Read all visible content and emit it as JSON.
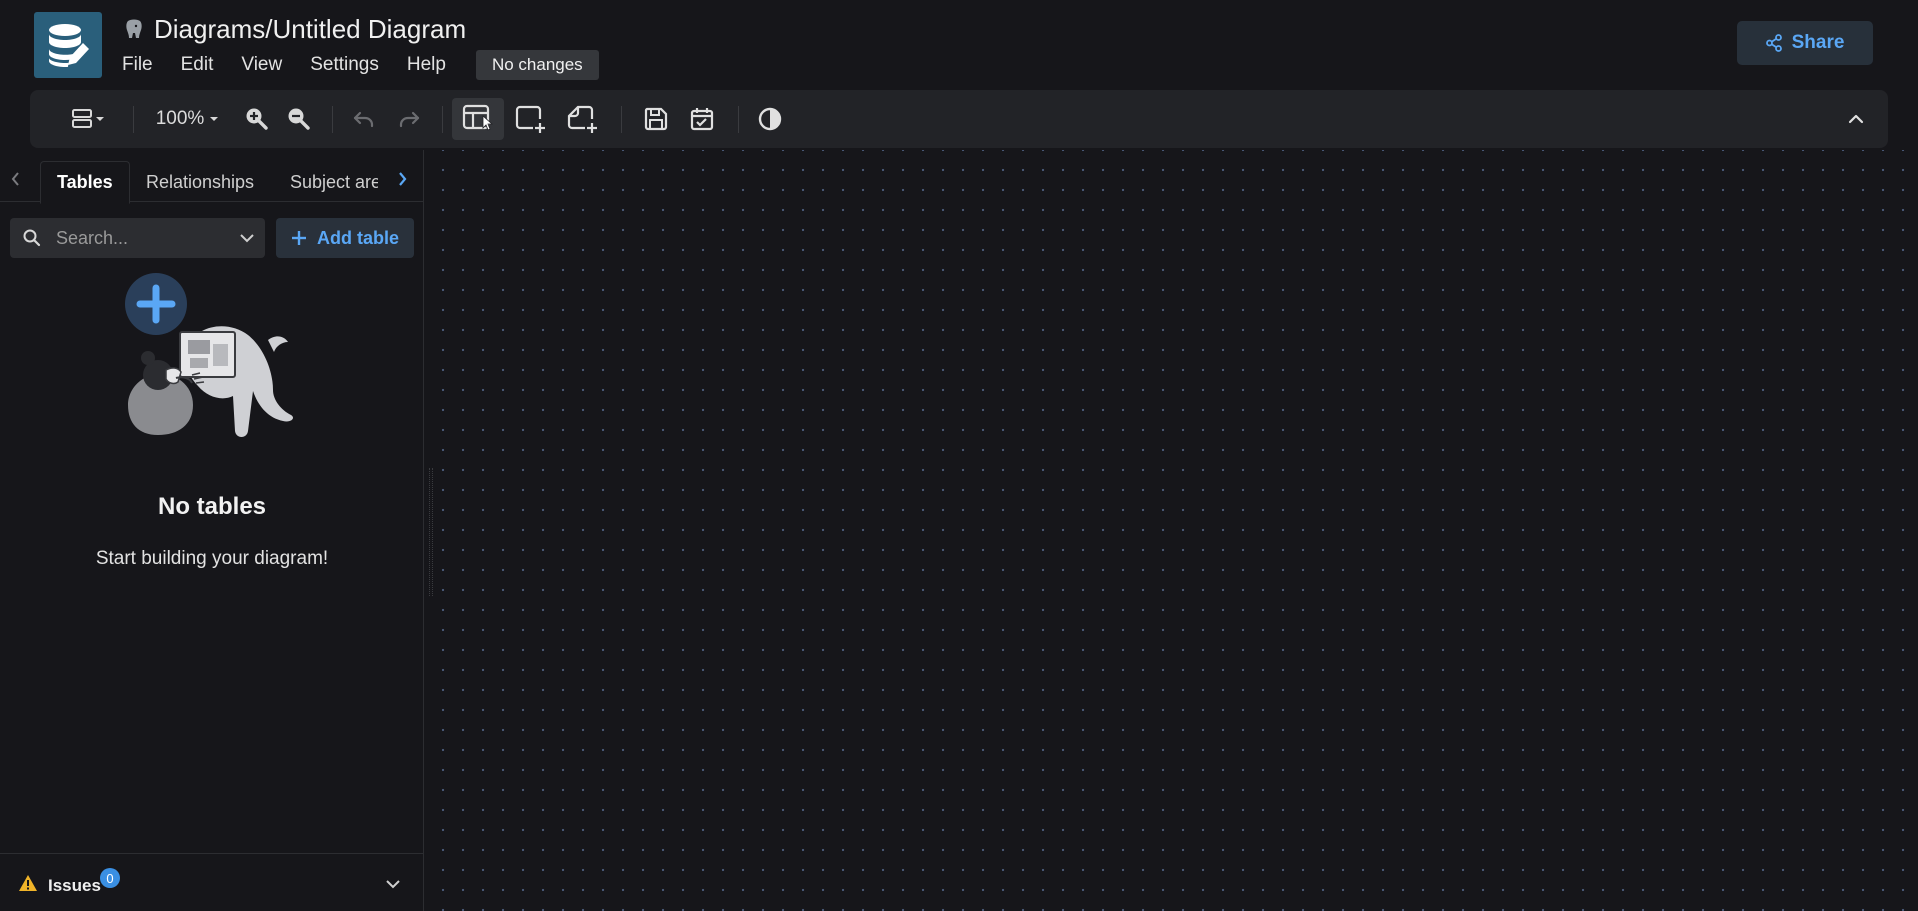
{
  "app": {
    "title": "Diagrams/Untitled Diagram",
    "save_status": "No changes",
    "share_label": "Share",
    "accent_color": "#5aa7f5",
    "logo_color": "#2a5f7b"
  },
  "menu": {
    "items": [
      {
        "label": "File"
      },
      {
        "label": "Edit"
      },
      {
        "label": "View"
      },
      {
        "label": "Settings"
      },
      {
        "label": "Help"
      }
    ]
  },
  "toolbar": {
    "layout_icon": "layout-icon",
    "zoom_level": "100%",
    "icons": [
      "zoom-in-icon",
      "zoom-out-icon",
      "undo-icon",
      "redo-icon",
      "add-table-icon",
      "add-area-icon",
      "add-note-icon",
      "save-icon",
      "todo-icon",
      "theme-toggle-icon",
      "collapse-toolbar-icon"
    ]
  },
  "sidebar": {
    "tabs": [
      {
        "label": "Tables",
        "active": true
      },
      {
        "label": "Relationships",
        "active": false
      },
      {
        "label": "Subject areas",
        "active": false
      }
    ],
    "search": {
      "placeholder": "Search..."
    },
    "add_table_label": "Add table",
    "empty_state": {
      "title": "No tables",
      "description": "Start building your diagram!"
    },
    "issues": {
      "label": "Issues",
      "count": "0"
    }
  }
}
